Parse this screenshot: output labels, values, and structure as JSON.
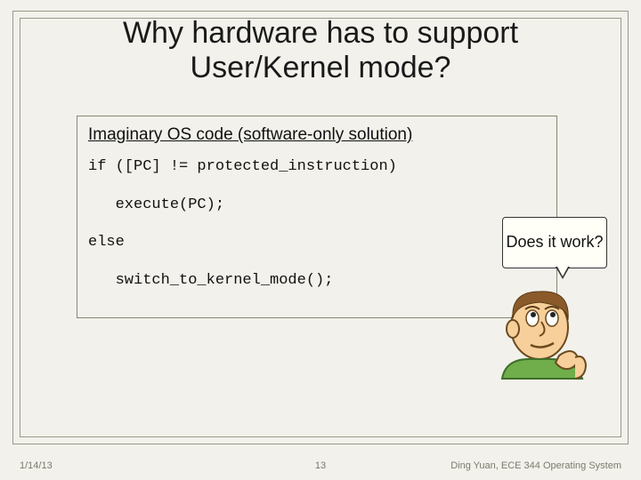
{
  "title_line1": "Why hardware has to support",
  "title_line2": "User/Kernel mode?",
  "code_heading": "Imaginary OS code (software-only solution)",
  "code": {
    "l1": "if ([PC] != protected_instruction)",
    "l2": "   execute(PC);",
    "l3": "else",
    "l4": "   switch_to_kernel_mode();"
  },
  "thought": "Does it work?",
  "footer": {
    "date": "1/14/13",
    "page": "13",
    "credit": "Ding Yuan, ECE 344 Operating System"
  }
}
